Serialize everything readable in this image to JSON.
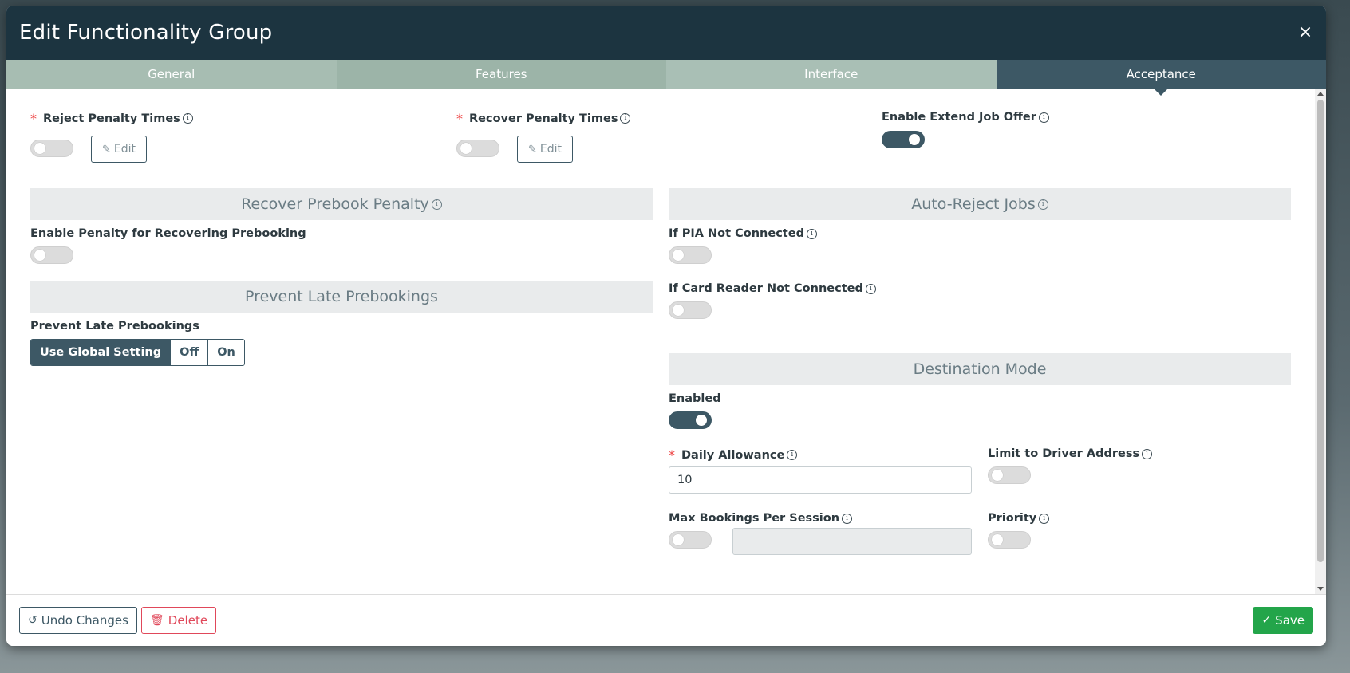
{
  "modal": {
    "title": "Edit Functionality Group",
    "close_icon": "×"
  },
  "tabs": [
    {
      "label": "General"
    },
    {
      "label": "Features"
    },
    {
      "label": "Interface"
    },
    {
      "label": "Acceptance",
      "active": true
    }
  ],
  "penalties": {
    "reject_label": "Reject Penalty Times",
    "reject_enabled": false,
    "recover_label": "Recover Penalty Times",
    "recover_enabled": false,
    "edit_label": "Edit",
    "extend_label": "Enable Extend Job Offer",
    "extend_enabled": true
  },
  "recover_prebook": {
    "section_title": "Recover Prebook Penalty",
    "enable_label": "Enable Penalty for Recovering Prebooking",
    "enabled": false
  },
  "prevent_late": {
    "section_title": "Prevent Late Prebookings",
    "field_label": "Prevent Late Prebookings",
    "options": [
      "Use Global Setting",
      "Off",
      "On"
    ],
    "selected": "Use Global Setting"
  },
  "auto_reject": {
    "section_title": "Auto-Reject Jobs",
    "pia_label": "If PIA Not Connected",
    "pia_enabled": false,
    "card_label": "If Card Reader Not Connected",
    "card_enabled": false
  },
  "destination_mode": {
    "section_title": "Destination Mode",
    "enabled_label": "Enabled",
    "enabled": true,
    "daily_label": "Daily Allowance",
    "daily_value": "10",
    "limit_label": "Limit to Driver Address",
    "limit_enabled": false,
    "max_label": "Max Bookings Per Session",
    "max_enabled": false,
    "max_value": "",
    "priority_label": "Priority",
    "priority_enabled": false
  },
  "footer": {
    "undo_label": "Undo Changes",
    "delete_label": "Delete",
    "save_label": "Save"
  },
  "colors": {
    "header": "#1c3440",
    "tab_active": "#3d5865",
    "tab_inactive": "#a7bdb2",
    "save": "#23a54a",
    "delete": "#e0485a",
    "required": "#ee4444"
  }
}
